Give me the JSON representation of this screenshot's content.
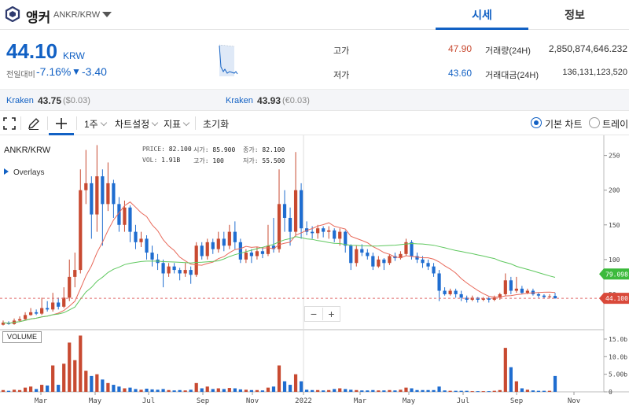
{
  "header": {
    "coin_name": "앵커",
    "pair": "ANKR/KRW",
    "tabs": [
      {
        "label": "시세"
      },
      {
        "label": "정보"
      }
    ]
  },
  "summary": {
    "price": "44.10",
    "unit": "KRW",
    "change_label": "전일대비",
    "change_pct": "-7.16%",
    "change_arrow": "▼",
    "change_abs": "-3.40",
    "high_label": "고가",
    "high": "47.90",
    "low_label": "저가",
    "low": "43.60",
    "volume_label": "거래량(24H)",
    "volume": "2,850,874,646.232",
    "amount_label": "거래대금(24H)",
    "amount": "136,131,123,520"
  },
  "exchanges": [
    {
      "name": "Kraken",
      "price": "43.75",
      "sub": "($0.03)"
    },
    {
      "name": "Kraken",
      "price": "43.93",
      "sub": "(€0.03)"
    }
  ],
  "toolbar": {
    "interval": "1주",
    "chart_settings": "차트설정",
    "indicators": "지표",
    "reset": "초기화",
    "radio_basic": "기본 차트",
    "radio_trading": "트레이딩"
  },
  "chart": {
    "pair": "ANKR/KRW",
    "overlays": "Overlays",
    "volume_title": "VOLUME",
    "ohlc": {
      "price_label": "PRICE:",
      "price": "82.100",
      "open_label": "시가:",
      "open": "85.900",
      "close_label": "종가:",
      "close": "82.100",
      "vol_label": "VOL:",
      "vol": "1.91B",
      "high_label": "고가:",
      "high": "100",
      "low_label": "저가:",
      "low": "55.500"
    },
    "zoom_out": "−",
    "zoom_in": "+",
    "ma_long_tag": "79.098",
    "price_tag": "44.100",
    "y_ticks": [
      "250",
      "200",
      "150",
      "100",
      "50"
    ],
    "vol_ticks": [
      "15.0b",
      "10.0b",
      "5.00b",
      "0"
    ],
    "x_ticks": [
      "Mar",
      "May",
      "Jul",
      "Sep",
      "Nov",
      "2022",
      "Mar",
      "May",
      "Jul",
      "Sep",
      "Nov"
    ]
  },
  "chart_data": {
    "type": "candlestick",
    "title": "ANKR/KRW",
    "y_range": [
      0,
      270
    ],
    "volume_range_billions": [
      0,
      17
    ],
    "candles": [
      {
        "o": 6,
        "c": 9,
        "h": 12,
        "l": 5,
        "v": 0.5
      },
      {
        "o": 9,
        "c": 7,
        "h": 11,
        "l": 6,
        "v": 0.3
      },
      {
        "o": 7,
        "c": 12,
        "h": 15,
        "l": 6,
        "v": 0.6
      },
      {
        "o": 12,
        "c": 14,
        "h": 18,
        "l": 11,
        "v": 0.5
      },
      {
        "o": 14,
        "c": 20,
        "h": 24,
        "l": 13,
        "v": 1.2
      },
      {
        "o": 20,
        "c": 24,
        "h": 30,
        "l": 19,
        "v": 1.5
      },
      {
        "o": 24,
        "c": 22,
        "h": 28,
        "l": 20,
        "v": 0.8
      },
      {
        "o": 22,
        "c": 30,
        "h": 45,
        "l": 20,
        "v": 2.0
      },
      {
        "o": 30,
        "c": 28,
        "h": 40,
        "l": 25,
        "v": 1.8
      },
      {
        "o": 28,
        "c": 38,
        "h": 52,
        "l": 25,
        "v": 7.5
      },
      {
        "o": 38,
        "c": 32,
        "h": 45,
        "l": 28,
        "v": 2.0
      },
      {
        "o": 32,
        "c": 45,
        "h": 60,
        "l": 30,
        "v": 8.0
      },
      {
        "o": 45,
        "c": 75,
        "h": 100,
        "l": 40,
        "v": 14.0
      },
      {
        "o": 75,
        "c": 85,
        "h": 110,
        "l": 60,
        "v": 9.0
      },
      {
        "o": 85,
        "c": 200,
        "h": 230,
        "l": 80,
        "v": 16.0
      },
      {
        "o": 200,
        "c": 210,
        "h": 258,
        "l": 180,
        "v": 6.0
      },
      {
        "o": 210,
        "c": 165,
        "h": 220,
        "l": 130,
        "v": 4.5
      },
      {
        "o": 165,
        "c": 220,
        "h": 265,
        "l": 140,
        "v": 5.0
      },
      {
        "o": 220,
        "c": 180,
        "h": 230,
        "l": 120,
        "v": 3.5
      },
      {
        "o": 180,
        "c": 210,
        "h": 240,
        "l": 170,
        "v": 2.5
      },
      {
        "o": 210,
        "c": 180,
        "h": 215,
        "l": 160,
        "v": 2.0
      },
      {
        "o": 180,
        "c": 150,
        "h": 190,
        "l": 140,
        "v": 1.5
      },
      {
        "o": 150,
        "c": 175,
        "h": 185,
        "l": 140,
        "v": 1.0
      },
      {
        "o": 175,
        "c": 140,
        "h": 178,
        "l": 125,
        "v": 1.2
      },
      {
        "o": 140,
        "c": 125,
        "h": 150,
        "l": 115,
        "v": 0.8
      },
      {
        "o": 125,
        "c": 130,
        "h": 140,
        "l": 118,
        "v": 0.6
      },
      {
        "o": 130,
        "c": 110,
        "h": 135,
        "l": 100,
        "v": 0.9
      },
      {
        "o": 110,
        "c": 100,
        "h": 120,
        "l": 90,
        "v": 0.7
      },
      {
        "o": 100,
        "c": 95,
        "h": 108,
        "l": 85,
        "v": 0.6
      },
      {
        "o": 95,
        "c": 80,
        "h": 100,
        "l": 60,
        "v": 0.8
      },
      {
        "o": 80,
        "c": 90,
        "h": 95,
        "l": 75,
        "v": 0.5
      },
      {
        "o": 90,
        "c": 85,
        "h": 95,
        "l": 80,
        "v": 0.4
      },
      {
        "o": 85,
        "c": 80,
        "h": 88,
        "l": 70,
        "v": 0.5
      },
      {
        "o": 80,
        "c": 85,
        "h": 95,
        "l": 75,
        "v": 0.4
      },
      {
        "o": 85,
        "c": 78,
        "h": 90,
        "l": 65,
        "v": 0.6
      },
      {
        "o": 78,
        "c": 120,
        "h": 125,
        "l": 75,
        "v": 2.5
      },
      {
        "o": 120,
        "c": 105,
        "h": 125,
        "l": 100,
        "v": 1.0
      },
      {
        "o": 105,
        "c": 125,
        "h": 130,
        "l": 100,
        "v": 1.5
      },
      {
        "o": 125,
        "c": 115,
        "h": 130,
        "l": 108,
        "v": 0.8
      },
      {
        "o": 115,
        "c": 130,
        "h": 140,
        "l": 110,
        "v": 1.0
      },
      {
        "o": 130,
        "c": 120,
        "h": 140,
        "l": 112,
        "v": 0.8
      },
      {
        "o": 120,
        "c": 140,
        "h": 150,
        "l": 115,
        "v": 1.1
      },
      {
        "o": 140,
        "c": 125,
        "h": 155,
        "l": 115,
        "v": 1.0
      },
      {
        "o": 125,
        "c": 100,
        "h": 130,
        "l": 95,
        "v": 0.7
      },
      {
        "o": 100,
        "c": 110,
        "h": 115,
        "l": 95,
        "v": 0.6
      },
      {
        "o": 110,
        "c": 105,
        "h": 115,
        "l": 95,
        "v": 0.5
      },
      {
        "o": 105,
        "c": 112,
        "h": 118,
        "l": 100,
        "v": 0.5
      },
      {
        "o": 112,
        "c": 108,
        "h": 118,
        "l": 102,
        "v": 0.4
      },
      {
        "o": 108,
        "c": 120,
        "h": 150,
        "l": 105,
        "v": 1.2
      },
      {
        "o": 120,
        "c": 115,
        "h": 160,
        "l": 110,
        "v": 1.5
      },
      {
        "o": 115,
        "c": 180,
        "h": 230,
        "l": 110,
        "v": 7.5
      },
      {
        "o": 180,
        "c": 160,
        "h": 200,
        "l": 140,
        "v": 3.0
      },
      {
        "o": 160,
        "c": 140,
        "h": 175,
        "l": 120,
        "v": 2.0
      },
      {
        "o": 140,
        "c": 200,
        "h": 255,
        "l": 135,
        "v": 5.0
      },
      {
        "o": 200,
        "c": 145,
        "h": 210,
        "l": 130,
        "v": 3.0
      },
      {
        "o": 145,
        "c": 140,
        "h": 155,
        "l": 135,
        "v": 0.6
      },
      {
        "o": 140,
        "c": 138,
        "h": 148,
        "l": 130,
        "v": 0.5
      },
      {
        "o": 138,
        "c": 145,
        "h": 150,
        "l": 130,
        "v": 0.5
      },
      {
        "o": 145,
        "c": 140,
        "h": 148,
        "l": 132,
        "v": 0.4
      },
      {
        "o": 140,
        "c": 142,
        "h": 148,
        "l": 130,
        "v": 0.5
      },
      {
        "o": 142,
        "c": 130,
        "h": 145,
        "l": 125,
        "v": 0.8
      },
      {
        "o": 130,
        "c": 140,
        "h": 145,
        "l": 120,
        "v": 1.0
      },
      {
        "o": 140,
        "c": 120,
        "h": 142,
        "l": 110,
        "v": 0.8
      },
      {
        "o": 120,
        "c": 95,
        "h": 122,
        "l": 85,
        "v": 0.6
      },
      {
        "o": 95,
        "c": 115,
        "h": 120,
        "l": 90,
        "v": 0.5
      },
      {
        "o": 115,
        "c": 110,
        "h": 122,
        "l": 105,
        "v": 0.4
      },
      {
        "o": 110,
        "c": 105,
        "h": 115,
        "l": 100,
        "v": 0.4
      },
      {
        "o": 105,
        "c": 90,
        "h": 110,
        "l": 85,
        "v": 0.5
      },
      {
        "o": 90,
        "c": 100,
        "h": 105,
        "l": 88,
        "v": 0.4
      },
      {
        "o": 100,
        "c": 95,
        "h": 102,
        "l": 85,
        "v": 0.4
      },
      {
        "o": 95,
        "c": 105,
        "h": 108,
        "l": 92,
        "v": 0.5
      },
      {
        "o": 105,
        "c": 102,
        "h": 110,
        "l": 98,
        "v": 0.4
      },
      {
        "o": 102,
        "c": 108,
        "h": 112,
        "l": 100,
        "v": 0.6
      },
      {
        "o": 108,
        "c": 125,
        "h": 130,
        "l": 105,
        "v": 1.2
      },
      {
        "o": 125,
        "c": 105,
        "h": 128,
        "l": 100,
        "v": 1.0
      },
      {
        "o": 105,
        "c": 100,
        "h": 110,
        "l": 95,
        "v": 0.5
      },
      {
        "o": 100,
        "c": 95,
        "h": 105,
        "l": 88,
        "v": 0.5
      },
      {
        "o": 95,
        "c": 90,
        "h": 100,
        "l": 85,
        "v": 0.5
      },
      {
        "o": 90,
        "c": 80,
        "h": 95,
        "l": 75,
        "v": 0.5
      },
      {
        "o": 80,
        "c": 55,
        "h": 85,
        "l": 40,
        "v": 1.5
      },
      {
        "o": 55,
        "c": 50,
        "h": 60,
        "l": 48,
        "v": 0.4
      },
      {
        "o": 50,
        "c": 55,
        "h": 58,
        "l": 48,
        "v": 0.3
      },
      {
        "o": 55,
        "c": 50,
        "h": 58,
        "l": 45,
        "v": 0.3
      },
      {
        "o": 50,
        "c": 45,
        "h": 55,
        "l": 40,
        "v": 0.3
      },
      {
        "o": 45,
        "c": 42,
        "h": 48,
        "l": 38,
        "v": 0.3
      },
      {
        "o": 42,
        "c": 45,
        "h": 48,
        "l": 40,
        "v": 0.2
      },
      {
        "o": 45,
        "c": 42,
        "h": 46,
        "l": 38,
        "v": 0.2
      },
      {
        "o": 42,
        "c": 44,
        "h": 46,
        "l": 40,
        "v": 0.2
      },
      {
        "o": 44,
        "c": 42,
        "h": 46,
        "l": 38,
        "v": 0.2
      },
      {
        "o": 42,
        "c": 45,
        "h": 48,
        "l": 40,
        "v": 0.3
      },
      {
        "o": 45,
        "c": 50,
        "h": 52,
        "l": 42,
        "v": 0.5
      },
      {
        "o": 50,
        "c": 70,
        "h": 80,
        "l": 48,
        "v": 12.5
      },
      {
        "o": 70,
        "c": 55,
        "h": 75,
        "l": 50,
        "v": 7.0
      },
      {
        "o": 55,
        "c": 58,
        "h": 75,
        "l": 52,
        "v": 3.0
      },
      {
        "o": 58,
        "c": 52,
        "h": 62,
        "l": 50,
        "v": 1.0
      },
      {
        "o": 52,
        "c": 55,
        "h": 58,
        "l": 50,
        "v": 0.6
      },
      {
        "o": 55,
        "c": 50,
        "h": 58,
        "l": 48,
        "v": 0.4
      },
      {
        "o": 50,
        "c": 48,
        "h": 52,
        "l": 45,
        "v": 0.3
      },
      {
        "o": 48,
        "c": 46,
        "h": 50,
        "l": 44,
        "v": 0.3
      },
      {
        "o": 46,
        "c": 47,
        "h": 50,
        "l": 44,
        "v": 0.3
      },
      {
        "o": 47.5,
        "c": 44.1,
        "h": 52,
        "l": 43.6,
        "v": 4.5
      }
    ],
    "ma_short_color": "#e8695a",
    "ma_long_color": "#5fc85f",
    "up_color": "#c84a31",
    "down_color": "#1f6dd0",
    "ma_long_last": 79.098,
    "last_price": 44.1
  }
}
